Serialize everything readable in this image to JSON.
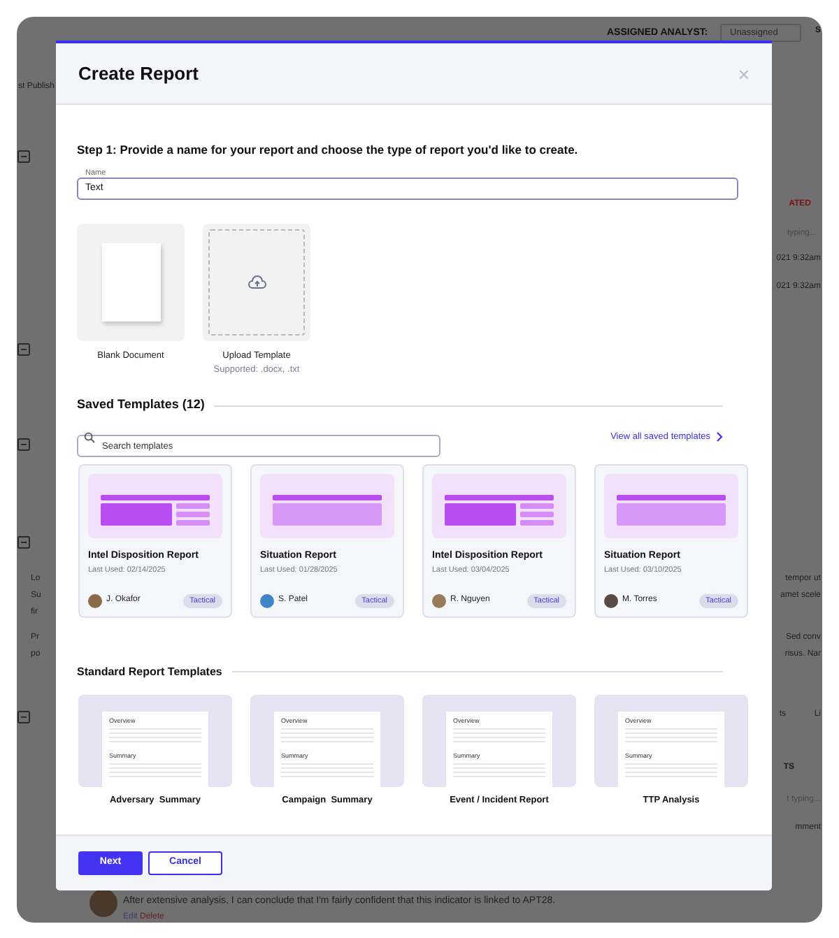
{
  "background": {
    "assigned_label": "ASSIGNED ANALYST:",
    "assigned_value": "Unassigned",
    "fragments": [
      {
        "text": "S",
        "kind": "bold"
      },
      {
        "text": "st Publish",
        "kind": "plain"
      },
      {
        "text": "ATED",
        "kind": "alert"
      },
      {
        "text": "typing...",
        "kind": "muted"
      },
      {
        "text": "021 9:32am",
        "kind": "plain"
      },
      {
        "text": "021 9:32am",
        "kind": "plain"
      },
      {
        "text": "Lo",
        "kind": "plain"
      },
      {
        "text": "Su",
        "kind": "plain"
      },
      {
        "text": "fir",
        "kind": "plain"
      },
      {
        "text": "Pr",
        "kind": "plain"
      },
      {
        "text": "po",
        "kind": "plain"
      },
      {
        "text": "tempor ut",
        "kind": "plain"
      },
      {
        "text": "amet scele",
        "kind": "plain"
      },
      {
        "text": "Sed conv",
        "kind": "plain"
      },
      {
        "text": "risus. Nar",
        "kind": "plain"
      },
      {
        "text": "ts",
        "kind": "plain"
      },
      {
        "text": "Li",
        "kind": "plain"
      },
      {
        "text": "TS",
        "kind": "bold"
      },
      {
        "text": "t typing...",
        "kind": "muted"
      },
      {
        "text": "mment",
        "kind": "plain"
      }
    ],
    "comment": {
      "text": "After extensive analysis, I can conclude that I'm fairly confident that this indicator is linked to APT28.",
      "actions": [
        "Edit",
        "Delete"
      ]
    }
  },
  "dialog": {
    "title": "Create Report",
    "close": "×",
    "step": "Step 1: Provide a name for your report and choose the type of report you'd like to create.",
    "name_field": {
      "label": "Name",
      "value": "Text"
    },
    "start_options": [
      {
        "kind": "blank",
        "label": "Blank Document"
      },
      {
        "kind": "upload",
        "label": "Upload Template",
        "hint": "Supported: .docx, .txt"
      }
    ],
    "saved": {
      "heading": "Saved Templates (12)",
      "search_placeholder": "Search templates",
      "view_all": "View all saved templates",
      "templates": [
        {
          "kind": "split",
          "title": "Intel Disposition Report",
          "last_used": "Last Used: 02/14/2025",
          "author": "J. Okafor",
          "color": "#8a6a4a",
          "tag": "Tactical"
        },
        {
          "kind": "wide",
          "title": "Situation Report",
          "last_used": "Last Used: 01/28/2025",
          "author": "S. Patel",
          "color": "#3f86c8",
          "tag": "Tactical"
        },
        {
          "kind": "split",
          "title": "Intel Disposition Report",
          "last_used": "Last Used: 03/04/2025",
          "author": "R. Nguyen",
          "color": "#9a7a5a",
          "tag": "Tactical"
        },
        {
          "kind": "wide",
          "title": "Situation Report",
          "last_used": "Last Used: 03/10/2025",
          "author": "M. Torres",
          "color": "#5a4a44",
          "tag": "Tactical"
        }
      ]
    },
    "standard": {
      "heading": "Standard Report Templates",
      "templates": [
        {
          "label": "Adversary  Summary",
          "sections": [
            "Overview",
            "Summary"
          ]
        },
        {
          "label": "Campaign  Summary",
          "sections": [
            "Overview",
            "Summary"
          ]
        },
        {
          "label": "Event / Incident Report",
          "sections": [
            "Overview",
            "Summary"
          ]
        },
        {
          "label": "TTP Analysis",
          "sections": [
            "Overview",
            "Summary"
          ]
        }
      ]
    },
    "buttons": {
      "primary": "Next",
      "secondary": "Cancel"
    }
  }
}
